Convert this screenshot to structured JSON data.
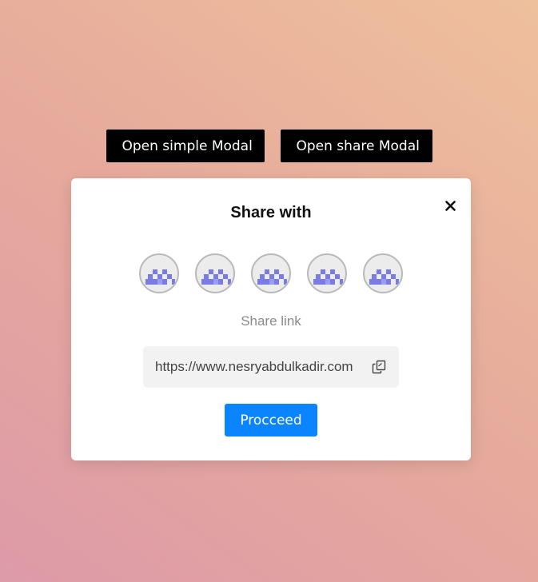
{
  "top_buttons": {
    "simple_label": "Open simple Modal",
    "share_label": "Open share Modal"
  },
  "modal": {
    "title": "Share with",
    "close_icon": "close-icon",
    "avatars": [
      {
        "icon": "placeholder-avatar-icon"
      },
      {
        "icon": "placeholder-avatar-icon"
      },
      {
        "icon": "placeholder-avatar-icon"
      },
      {
        "icon": "placeholder-avatar-icon"
      },
      {
        "icon": "placeholder-avatar-icon"
      }
    ],
    "share_link_label": "Share link",
    "link_url": "https://www.nesryabdulkadir.com",
    "copy_icon": "copy-icon",
    "proceed_label": "Procceed"
  },
  "colors": {
    "top_button_bg": "#000000",
    "proceed_button_bg": "#0a84ff",
    "avatar_pattern": "#7b7be6"
  }
}
